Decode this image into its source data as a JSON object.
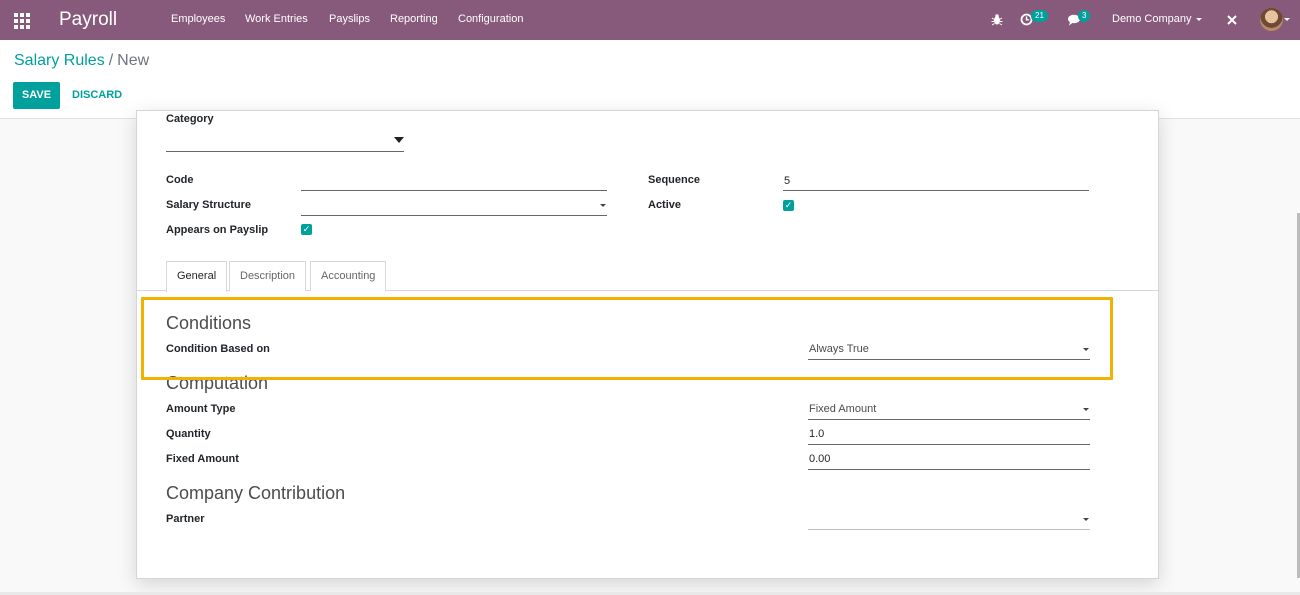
{
  "navbar": {
    "app_name": "Payroll",
    "menu": [
      "Employees",
      "Work Entries",
      "Payslips",
      "Reporting",
      "Configuration"
    ],
    "activities_count": "21",
    "messages_count": "3",
    "company": "Demo Company",
    "icons": [
      "apps-icon",
      "bug-icon",
      "clock-icon",
      "chat-icon",
      "close-icon",
      "avatar"
    ]
  },
  "breadcrumb": {
    "parent": "Salary Rules",
    "separator": "/",
    "current": "New"
  },
  "buttons": {
    "save": "SAVE",
    "discard": "DISCARD"
  },
  "form": {
    "category_label": "Category",
    "code_label": "Code",
    "salary_structure_label": "Salary Structure",
    "appears_on_payslip_label": "Appears on Payslip",
    "appears_on_payslip": true,
    "sequence_label": "Sequence",
    "sequence_value": "5",
    "active_label": "Active",
    "active": true
  },
  "tabs": [
    "General",
    "Description",
    "Accounting"
  ],
  "active_tab": "General",
  "general": {
    "conditions_title": "Conditions",
    "condition_based_on_label": "Condition Based on",
    "condition_based_on_value": "Always True",
    "computation_title": "Computation",
    "amount_type_label": "Amount Type",
    "amount_type_value": "Fixed Amount",
    "quantity_label": "Quantity",
    "quantity_value": "1.0",
    "fixed_amount_label": "Fixed Amount",
    "fixed_amount_value": "0.00",
    "company_contribution_title": "Company Contribution",
    "partner_label": "Partner",
    "partner_value": ""
  },
  "colors": {
    "navbar": "#875a7b",
    "accent": "#00a09d",
    "highlight": "#f2b300"
  }
}
